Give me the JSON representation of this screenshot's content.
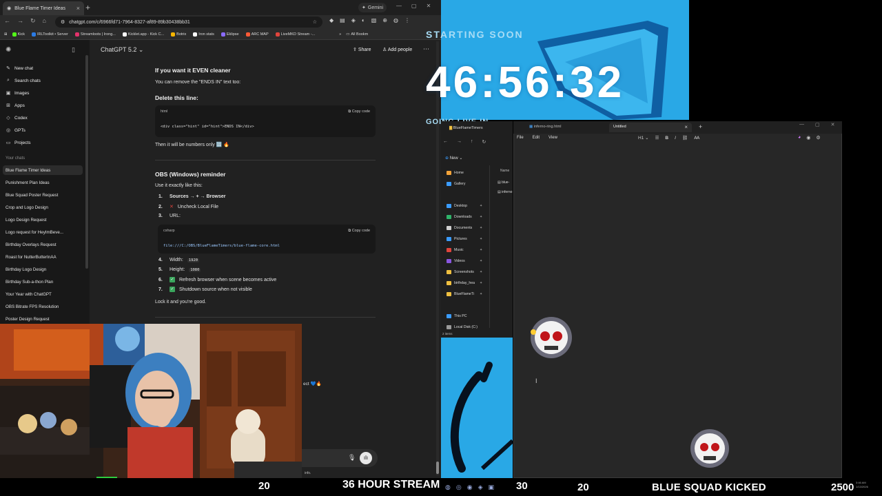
{
  "chrome": {
    "tab_title": "Blue Flame Timer Ideas",
    "gemini": "Gemini",
    "url": "chatgpt.com/c/6966fd71-7964-8327-af89-89b30438bb31",
    "bookmarks": [
      "Kick",
      "IRLToolkit • Server",
      "Streamloots | Irong...",
      "Kicklet.app - Kick C...",
      "Botrix",
      "Iron stats",
      "Eklipse",
      "ARC MAP",
      "LiveMKD Stream -..."
    ],
    "bookmark_colors": [
      "#53fc18",
      "#2b7be4",
      "#e3326b",
      "#ffffff",
      "#f7b500",
      "#ffffff",
      "#8a6bff",
      "#ff5a36",
      "#e0443c"
    ],
    "all_bookmarks": "All Bookm"
  },
  "sidebar": {
    "nav": [
      {
        "icon": "✎",
        "label": "New chat"
      },
      {
        "icon": "⌕",
        "label": "Search chats"
      },
      {
        "icon": "▣",
        "label": "Images"
      },
      {
        "icon": "⊞",
        "label": "Apps"
      },
      {
        "icon": "◇",
        "label": "Codex"
      },
      {
        "icon": "◎",
        "label": "GPTs"
      },
      {
        "icon": "▭",
        "label": "Projects"
      }
    ],
    "your_chats": "Your chats",
    "chats": [
      "Blue Flame Timer Ideas",
      "Punishment Plan Ideas",
      "Blue Squad Poster Request",
      "Crop and Logo Design",
      "Logo Design Request",
      "Logo request for HeyImBeve...",
      "Birthday Overlays Request",
      "Roast for NutterButterInAA",
      "Birthday Logo Design",
      "Birthday Sub-a-thon Plan",
      "Your Year with ChatGPT",
      "OBS Bitrate FPS Resolution",
      "Poster Design Request"
    ]
  },
  "header": {
    "model": "ChatGPT 5.2",
    "share": "Share",
    "add_people": "Add people"
  },
  "content": {
    "h1": "If you want it EVEN cleaner",
    "p1": "You can remove the \"ENDS IN\" text too:",
    "h2": "Delete this line:",
    "code1": {
      "lang": "html",
      "copy": "Copy code",
      "line": "<div class=\"hint\" id=\"hint\">ENDS IN</div>"
    },
    "p2": "Then it will be numbers only 🔢 🔥",
    "h3": "OBS (Windows) reminder",
    "p3": "Use it exactly like this:",
    "steps": [
      {
        "n": "1.",
        "text": "Sources → + → Browser"
      },
      {
        "n": "2.",
        "text": "Uncheck Local File"
      },
      {
        "n": "3.",
        "text": "URL:"
      }
    ],
    "code2": {
      "lang": "csharp",
      "copy": "Copy code",
      "line": "file:///C:/OBS/BlueFlameTimers/blue-flame-core.html"
    },
    "steps2": [
      {
        "n": "4.",
        "label": "Width:",
        "val": "1920"
      },
      {
        "n": "5.",
        "label": "Height:",
        "val": "1080"
      },
      {
        "n": "6.",
        "text": "Refresh browser when scene becomes active"
      },
      {
        "n": "7.",
        "text": "Shutdown source when not visible"
      }
    ],
    "p4": "Lock it and you're good.",
    "tail": "ect 💙🔥",
    "info": "info."
  },
  "overlay": {
    "starting": "STARTING SOON",
    "timer": "46:56:32",
    "going_live": "GOING LIVE IN"
  },
  "explorer": {
    "title": "BlueFlameTimers",
    "new": "New",
    "items": [
      "Home",
      "Gallery",
      "Desktop",
      "Downloads",
      "Documents",
      "Pictures",
      "Music",
      "Videos",
      "Screenshots",
      "birthday_hea",
      "BlueFlameTi",
      "This PC",
      "Local Disk (C:)"
    ],
    "col_name": "Name",
    "files": [
      "blue-",
      "inferno"
    ],
    "count": "2 items"
  },
  "notepad": {
    "tab1": "inferno-ring.html",
    "tab2": "Untitled",
    "menu": [
      "File",
      "Edit",
      "View"
    ],
    "heading_tool": "H1"
  },
  "ticker": {
    "n1": "20",
    "stream": "36 HOUR STREAM",
    "n2": "30",
    "n3": "20",
    "kicked": "BLUE SQUAD KICKED",
    "n4": "2500",
    "time": "3:46 AM",
    "date": "1/13/2026"
  }
}
